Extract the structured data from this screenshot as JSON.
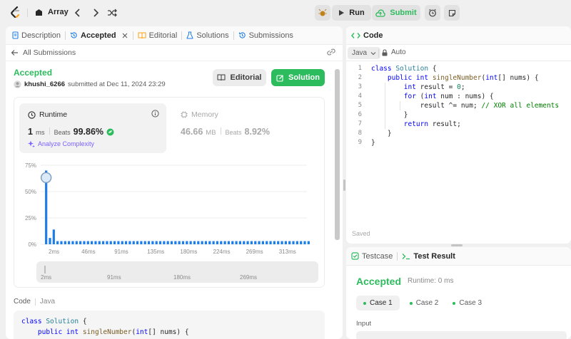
{
  "topbar": {
    "problem_list_label": "Array",
    "run_label": "Run",
    "submit_label": "Submit"
  },
  "left_tabs": [
    {
      "label": "Description"
    },
    {
      "label": "Accepted"
    },
    {
      "label": "Editorial"
    },
    {
      "label": "Solutions"
    },
    {
      "label": "Submissions"
    }
  ],
  "submission": {
    "back_label": "All Submissions",
    "status": "Accepted",
    "username": "khushi_6266",
    "submitted_text": "submitted at Dec 11, 2024 23:29",
    "editorial_btn": "Editorial",
    "solution_btn": "Solution"
  },
  "runtime": {
    "title": "Runtime",
    "value": "1",
    "unit": "ms",
    "beats_label": "Beats",
    "beats_value": "99.86%",
    "analyze_label": "Analyze Complexity"
  },
  "memory": {
    "title": "Memory",
    "value": "46.66",
    "unit": "MB",
    "beats_label": "Beats",
    "beats_value": "8.92%"
  },
  "chart_data": {
    "type": "bar",
    "title": "",
    "y_ticks": [
      "75%",
      "50%",
      "25%",
      "0%"
    ],
    "x_ticks": [
      "2ms",
      "46ms",
      "91ms",
      "135ms",
      "180ms",
      "224ms",
      "269ms",
      "313ms"
    ],
    "ylim": [
      0,
      75
    ],
    "values": [
      70,
      6,
      14,
      3,
      3,
      3,
      3,
      3,
      3,
      3,
      3,
      3,
      3,
      3,
      3,
      3,
      3,
      3,
      3,
      3,
      3,
      3,
      3,
      3,
      3,
      3,
      3,
      3,
      3,
      3,
      3,
      3,
      3,
      3,
      3,
      3,
      3,
      3,
      3,
      3,
      3,
      3,
      3,
      3,
      3,
      3,
      3,
      3,
      3,
      3,
      3,
      3,
      3,
      3,
      3,
      3,
      3,
      3,
      3,
      3,
      3,
      3,
      3,
      3,
      3,
      3,
      3,
      3,
      3,
      3
    ],
    "highlight_index": 0,
    "overview_ticks": [
      "2ms",
      "91ms",
      "180ms",
      "269ms"
    ],
    "colors": {
      "bar": "#1e7ee8",
      "accent": "#2cbb5d"
    }
  },
  "code_section": {
    "label": "Code",
    "lang": "Java",
    "lines": [
      [
        {
          "t": "class ",
          "c": "kw"
        },
        {
          "t": "Solution",
          "c": "cls"
        },
        {
          "t": " {",
          "c": ""
        }
      ],
      [
        {
          "t": "    public ",
          "c": "kw"
        },
        {
          "t": "int ",
          "c": "kw"
        },
        {
          "t": "singleNumber",
          "c": "fn"
        },
        {
          "t": "(",
          "c": ""
        },
        {
          "t": "int",
          "c": "kw"
        },
        {
          "t": "[] nums) {",
          "c": ""
        }
      ]
    ]
  },
  "editor": {
    "tab_label": "Code",
    "language": "Java",
    "mode": "Auto",
    "saved_label": "Saved",
    "line_numbers": [
      "1",
      "2",
      "3",
      "4",
      "5",
      "6",
      "7",
      "8",
      "9"
    ],
    "lines": [
      [
        {
          "t": "class ",
          "c": "kw"
        },
        {
          "t": "Solution",
          "c": "cls"
        },
        {
          "t": " {",
          "c": ""
        }
      ],
      [
        {
          "t": "    public ",
          "c": "kw"
        },
        {
          "t": "int ",
          "c": "kw"
        },
        {
          "t": "singleNumber",
          "c": "fn"
        },
        {
          "t": "(",
          "c": ""
        },
        {
          "t": "int",
          "c": "kw"
        },
        {
          "t": "[] nums) {",
          "c": ""
        }
      ],
      [
        {
          "t": "        int ",
          "c": "kw"
        },
        {
          "t": "result = ",
          "c": ""
        },
        {
          "t": "0",
          "c": "num"
        },
        {
          "t": ";",
          "c": ""
        }
      ],
      [
        {
          "t": "        for ",
          "c": "kw"
        },
        {
          "t": "(",
          "c": ""
        },
        {
          "t": "int ",
          "c": "kw"
        },
        {
          "t": "num : nums) {",
          "c": ""
        }
      ],
      [
        {
          "t": "            result ^= num; ",
          "c": ""
        },
        {
          "t": "// XOR all elements",
          "c": "cm"
        }
      ],
      [
        {
          "t": "        }",
          "c": ""
        }
      ],
      [
        {
          "t": "        return ",
          "c": "kw"
        },
        {
          "t": "result;",
          "c": ""
        }
      ],
      [
        {
          "t": "    }",
          "c": ""
        }
      ],
      [
        {
          "t": "}",
          "c": ""
        }
      ]
    ]
  },
  "test_panel": {
    "testcase_tab": "Testcase",
    "result_tab": "Test Result",
    "status": "Accepted",
    "runtime_text": "Runtime: 0 ms",
    "cases": [
      "Case 1",
      "Case 2",
      "Case 3"
    ],
    "input_label": "Input"
  }
}
